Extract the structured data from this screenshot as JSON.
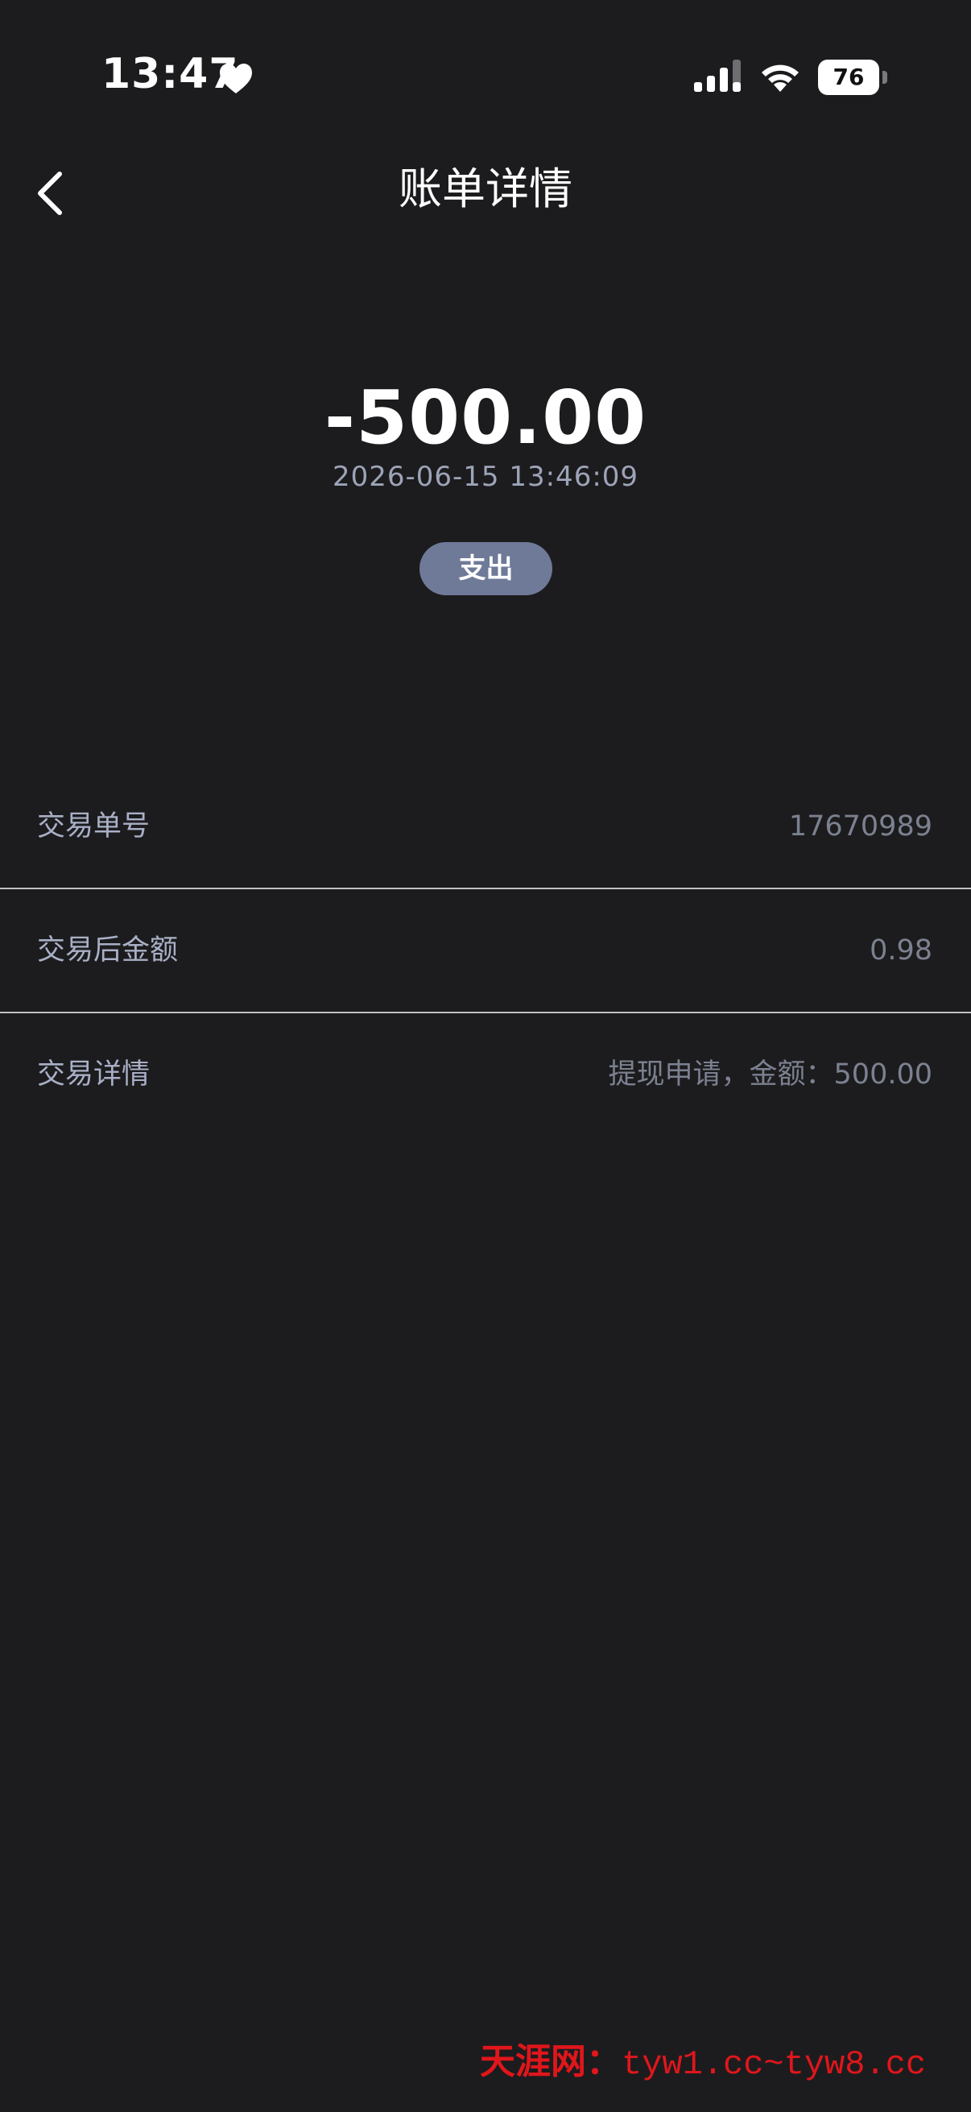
{
  "status_bar": {
    "time": "13:47",
    "battery": "76",
    "icons": [
      "heart-icon",
      "signal-icon",
      "wifi-icon",
      "battery-icon"
    ]
  },
  "header": {
    "title": "账单详情",
    "back_icon": "chevron-left-icon"
  },
  "summary": {
    "amount": "-500.00",
    "timestamp": "2026-06-15 13:46:09",
    "type_badge": "支出",
    "badge_color": "#6f7a98"
  },
  "details": [
    {
      "label": "交易单号",
      "value": "17670989"
    },
    {
      "label": "交易后金额",
      "value": "0.98"
    },
    {
      "label": "交易详情",
      "value": "提现申请，金额：500.00"
    }
  ],
  "watermark": {
    "text_cn": "天涯网：",
    "text_url": "tyw1.cc~tyw8.cc",
    "color": "#e0161b"
  },
  "colors": {
    "background": "#1c1c1e",
    "label": "#a9b0c6",
    "value": "#7c8190"
  }
}
